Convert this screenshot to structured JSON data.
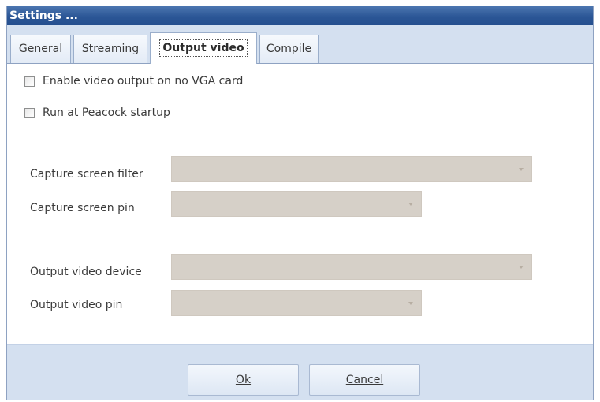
{
  "window": {
    "title": "Settings ..."
  },
  "tabs": [
    {
      "label": "General",
      "active": false
    },
    {
      "label": "Streaming",
      "active": false
    },
    {
      "label": "Output video",
      "active": true
    },
    {
      "label": "Compile",
      "active": false
    }
  ],
  "options": {
    "enable_video_output": {
      "label": "Enable video output on no VGA card",
      "checked": false
    },
    "run_at_startup": {
      "label": "Run at Peacock startup",
      "checked": false
    }
  },
  "fields": {
    "capture_screen_filter": {
      "label": "Capture screen filter",
      "value": ""
    },
    "capture_screen_pin": {
      "label": "Capture screen pin",
      "value": ""
    },
    "output_video_device": {
      "label": "Output video device",
      "value": ""
    },
    "output_video_pin": {
      "label": "Output video pin",
      "value": ""
    }
  },
  "buttons": {
    "ok": {
      "label": "Ok"
    },
    "cancel": {
      "label": "Cancel"
    }
  },
  "colors": {
    "titlebar": "#2b5696",
    "tabstrip": "#d4e0f0",
    "combo_disabled": "#d6d0c8"
  }
}
